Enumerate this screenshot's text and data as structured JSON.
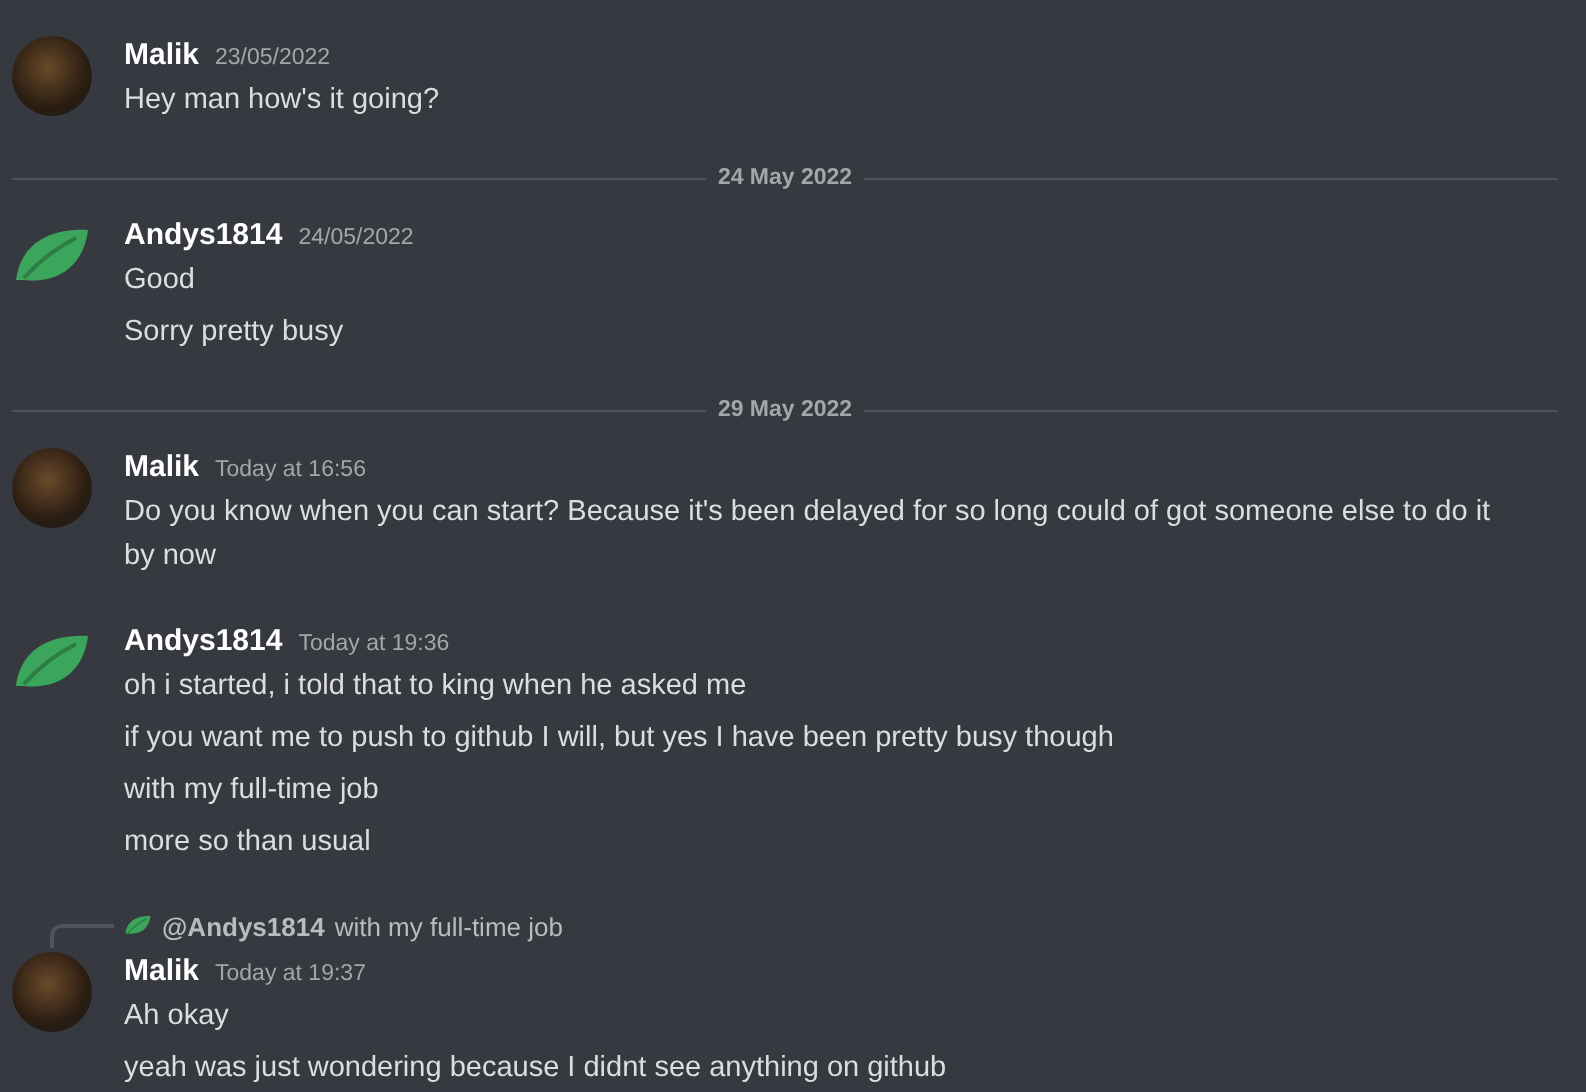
{
  "feed": [
    {
      "kind": "message",
      "avatar": {
        "kind": "photo"
      },
      "author": "Malik",
      "time": "23/05/2022",
      "lines": [
        "Hey man how's it going?"
      ]
    },
    {
      "kind": "divider",
      "date": "24 May 2022"
    },
    {
      "kind": "message",
      "avatar": {
        "kind": "leaf"
      },
      "author": "Andys1814",
      "time": "24/05/2022",
      "lines": [
        "Good",
        "Sorry pretty busy"
      ]
    },
    {
      "kind": "divider",
      "date": "29 May 2022"
    },
    {
      "kind": "message",
      "avatar": {
        "kind": "photo"
      },
      "author": "Malik",
      "time": "Today at 16:56",
      "lines": [
        "Do you know when you can start? Because it's been delayed for so long could of got someone else to do it by now"
      ]
    },
    {
      "kind": "message",
      "avatar": {
        "kind": "leaf"
      },
      "author": "Andys1814",
      "time": "Today at 19:36",
      "lines": [
        "oh i started, i told that to king when he asked me",
        "if you want me to push to github I will, but yes I have been pretty busy though",
        "with my full-time job",
        "more so than usual"
      ]
    },
    {
      "kind": "message",
      "avatar": {
        "kind": "photo"
      },
      "author": "Malik",
      "time": "Today at 19:37",
      "reply": {
        "avatar": {
          "kind": "leaf"
        },
        "author": "@Andys1814",
        "text": "with my full-time job"
      },
      "lines": [
        "Ah okay",
        "yeah was just wondering because I didnt see anything on github"
      ]
    }
  ]
}
